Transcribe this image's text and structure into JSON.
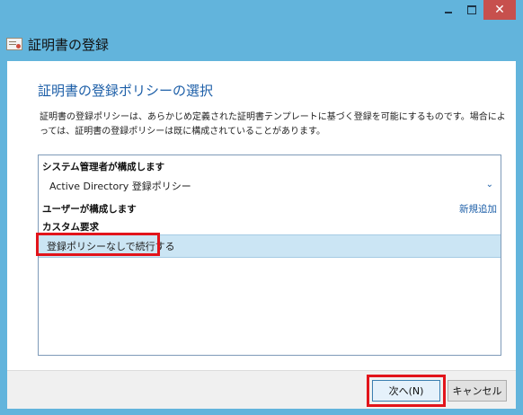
{
  "header": {
    "title": "証明書の登録"
  },
  "main": {
    "heading": "証明書の登録ポリシーの選択",
    "description": "証明書の登録ポリシーは、あらかじめ定義された証明書テンプレートに基づく登録を可能にするものです。場合によっては、証明書の登録ポリシーは既に構成されていることがあります。"
  },
  "policy_list": {
    "admin_group": "システム管理者が構成します",
    "admin_policy": "Active Directory 登録ポリシー",
    "user_group": "ユーザーが構成します",
    "add_new": "新規追加",
    "custom_group": "カスタム要求",
    "proceed_without_policy": "登録ポリシーなしで続行する"
  },
  "footer": {
    "next_label": "次へ(N)",
    "cancel_label": "キャンセル"
  },
  "colors": {
    "accent": "#1d5fa8",
    "frame": "#62b4dc",
    "highlight": "#e2141b",
    "selection": "#cbe5f4"
  },
  "icons": {
    "window": "certificate-icon",
    "expand": "chevron-down-icon"
  }
}
